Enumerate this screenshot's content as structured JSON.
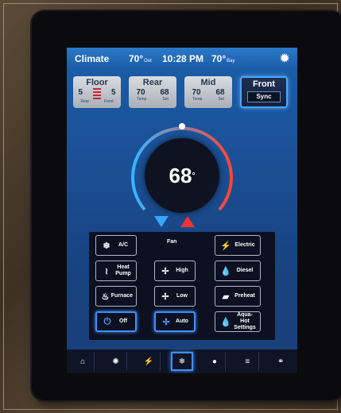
{
  "topbar": {
    "title": "Climate",
    "temp_left": "70",
    "temp_left_unit": "°",
    "temp_left_sub": "Out",
    "time": "10:28 PM",
    "temp_right": "70",
    "temp_right_unit": "°",
    "temp_right_sub": "Bay",
    "gear_icon": "gear-icon"
  },
  "zones": {
    "floor": {
      "name": "Floor",
      "left_val": "5",
      "right_val": "5",
      "left_lbl": "Rear",
      "right_lbl": "Front"
    },
    "rear": {
      "name": "Rear",
      "left_val": "70",
      "right_val": "68",
      "left_lbl": "Temp",
      "right_lbl": "Set"
    },
    "mid": {
      "name": "Mid",
      "left_val": "70",
      "right_val": "68",
      "left_lbl": "Temp",
      "right_lbl": "Set"
    },
    "front": {
      "name": "Front",
      "sync_label": "Sync"
    }
  },
  "dial": {
    "setpoint": "68",
    "unit": "°"
  },
  "controls": {
    "fan_label": "Fan",
    "ac": "A/C",
    "electric": "Electric",
    "heat_pump": "Heat Pump",
    "high": "High",
    "diesel": "Diesel",
    "furnace": "Furnace",
    "low": "Low",
    "preheat": "Preheat",
    "off": "Off",
    "auto": "Auto",
    "aqua_hot": "Aqua-Hot Settings"
  },
  "nav": [
    "home-icon",
    "light-icon",
    "power-icon",
    "climate-icon",
    "shade-icon",
    "menu-icon",
    "connect-icon"
  ],
  "colors": {
    "accent": "#3f90ff",
    "cool": "#39a6ff",
    "heat": "#e33333"
  }
}
